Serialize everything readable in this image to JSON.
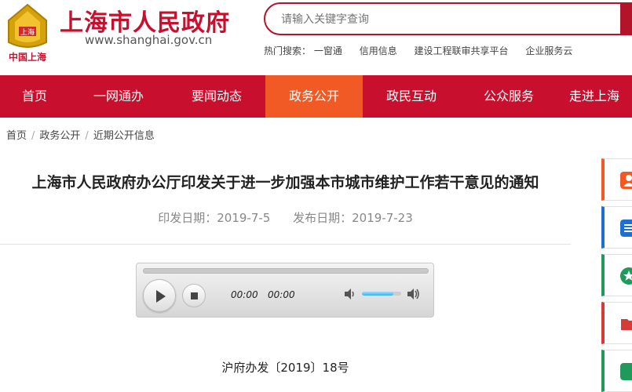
{
  "header": {
    "site_title": "上海市人民政府",
    "site_url": "www.shanghai.gov.cn",
    "logo_caption": "中国上海",
    "search": {
      "placeholder": "请输入关键字查询"
    },
    "hot_label": "热门搜索：",
    "hot_links": [
      "一窗通",
      "信用信息",
      "建设工程联审共享平台",
      "企业服务云"
    ]
  },
  "nav": {
    "items": [
      {
        "label": "首页"
      },
      {
        "label": "一网通办"
      },
      {
        "label": "要闻动态"
      },
      {
        "label": "政务公开",
        "active": true
      },
      {
        "label": "政民互动"
      },
      {
        "label": "公众服务"
      },
      {
        "label": "走进上海"
      }
    ]
  },
  "breadcrumb": [
    "首页",
    "政务公开",
    "近期公开信息"
  ],
  "article": {
    "title": "上海市人民政府办公厅印发关于进一步加强本市城市维护工作若干意见的通知",
    "issue_date": "印发日期：2019-7-5",
    "publish_date": "发布日期：2019-7-23",
    "doc_number": "沪府办发〔2019〕18号"
  },
  "player": {
    "current_time": "00:00",
    "duration": "00:00",
    "volume_level": 0.8
  },
  "side_tabs": [
    {
      "icon": "user-icon",
      "color": "#f15a24"
    },
    {
      "icon": "list-icon",
      "color": "#1f6fd0"
    },
    {
      "icon": "star-icon",
      "color": "#1f9a5a"
    },
    {
      "icon": "folder-icon",
      "color": "#d83a3a"
    },
    {
      "icon": "more-icon",
      "color": "#1f9a5a"
    }
  ],
  "colors": {
    "brand_red": "#c8102e",
    "active_orange": "#f15a24"
  }
}
